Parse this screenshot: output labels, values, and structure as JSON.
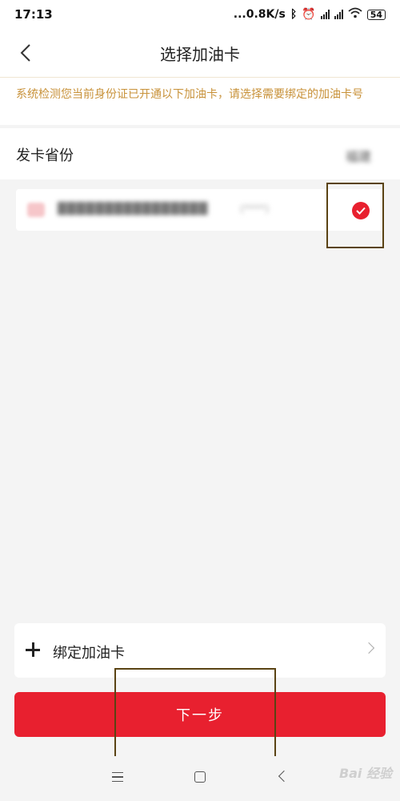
{
  "status": {
    "time": "17:13",
    "speed": "...0.8K/s",
    "hd_label": "HD",
    "battery": "54"
  },
  "header": {
    "title": "选择加油卡"
  },
  "notice": {
    "text": "系统检测您当前身份证已开通以下加油卡，请选择需要绑定的加油卡号"
  },
  "province": {
    "label": "发卡省份",
    "value": "福建"
  },
  "card": {
    "name": "████████████████",
    "sub": "(****)",
    "selected": true
  },
  "bind": {
    "label": "绑定加油卡"
  },
  "next_button": {
    "label": "下一步"
  },
  "watermark": {
    "text": "Bai 经验"
  },
  "colors": {
    "accent": "#e8202f",
    "notice": "#c8923a",
    "highlight": "#5a4313"
  }
}
